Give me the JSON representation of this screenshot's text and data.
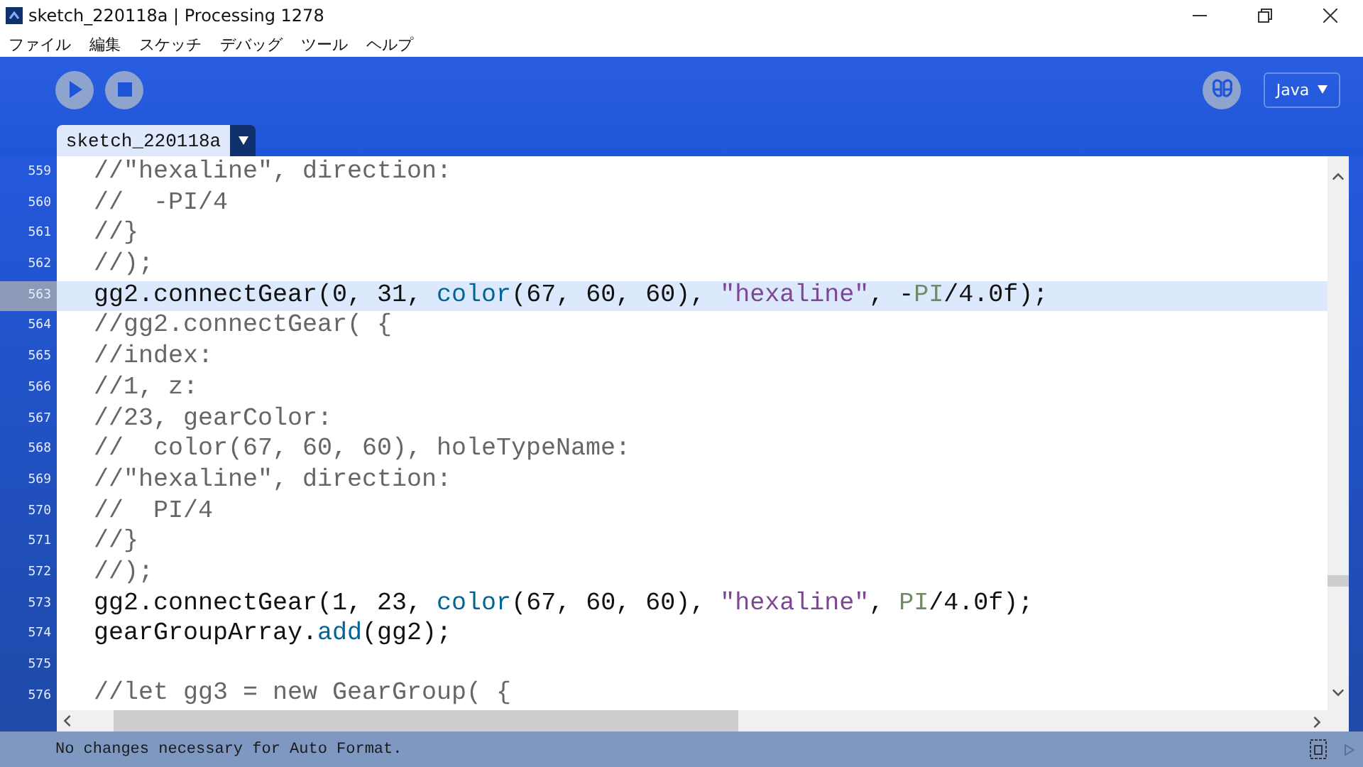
{
  "window": {
    "title": "sketch_220118a | Processing 1278"
  },
  "menu": [
    "ファイル",
    "編集",
    "スケッチ",
    "デバッグ",
    "ツール",
    "ヘルプ"
  ],
  "tabs": [
    {
      "label": "sketch_220118a",
      "selected": true
    }
  ],
  "mode": {
    "label": "Java"
  },
  "editor": {
    "lines": [
      {
        "number": "559",
        "current": false,
        "tokens": [
          {
            "kind": "comment",
            "text": "//\"hexaline\", direction:"
          }
        ]
      },
      {
        "number": "560",
        "current": false,
        "tokens": [
          {
            "kind": "comment",
            "text": "//  -PI/4"
          }
        ]
      },
      {
        "number": "561",
        "current": false,
        "tokens": [
          {
            "kind": "comment",
            "text": "//}"
          }
        ]
      },
      {
        "number": "562",
        "current": false,
        "tokens": [
          {
            "kind": "comment",
            "text": "//);"
          }
        ]
      },
      {
        "number": "563",
        "current": true,
        "tokens": [
          {
            "kind": "plain",
            "text": "gg2.connectGear(0, 31, "
          },
          {
            "kind": "keyword",
            "text": "color"
          },
          {
            "kind": "plain",
            "text": "(67, 60, 60), "
          },
          {
            "kind": "string",
            "text": "\"hexaline\""
          },
          {
            "kind": "plain",
            "text": ", -"
          },
          {
            "kind": "constant",
            "text": "PI"
          },
          {
            "kind": "plain",
            "text": "/4.0f);"
          }
        ]
      },
      {
        "number": "564",
        "current": false,
        "tokens": [
          {
            "kind": "comment",
            "text": "//gg2.connectGear( {"
          }
        ]
      },
      {
        "number": "565",
        "current": false,
        "tokens": [
          {
            "kind": "comment",
            "text": "//index:"
          }
        ]
      },
      {
        "number": "566",
        "current": false,
        "tokens": [
          {
            "kind": "comment",
            "text": "//1, z:"
          }
        ]
      },
      {
        "number": "567",
        "current": false,
        "tokens": [
          {
            "kind": "comment",
            "text": "//23, gearColor:"
          }
        ]
      },
      {
        "number": "568",
        "current": false,
        "tokens": [
          {
            "kind": "comment",
            "text": "//  color(67, 60, 60), holeTypeName:"
          }
        ]
      },
      {
        "number": "569",
        "current": false,
        "tokens": [
          {
            "kind": "comment",
            "text": "//\"hexaline\", direction:"
          }
        ]
      },
      {
        "number": "570",
        "current": false,
        "tokens": [
          {
            "kind": "comment",
            "text": "//  PI/4"
          }
        ]
      },
      {
        "number": "571",
        "current": false,
        "tokens": [
          {
            "kind": "comment",
            "text": "//}"
          }
        ]
      },
      {
        "number": "572",
        "current": false,
        "tokens": [
          {
            "kind": "comment",
            "text": "//);"
          }
        ]
      },
      {
        "number": "573",
        "current": false,
        "tokens": [
          {
            "kind": "plain",
            "text": "gg2.connectGear(1, 23, "
          },
          {
            "kind": "keyword",
            "text": "color"
          },
          {
            "kind": "plain",
            "text": "(67, 60, 60), "
          },
          {
            "kind": "string",
            "text": "\"hexaline\""
          },
          {
            "kind": "plain",
            "text": ", "
          },
          {
            "kind": "constant",
            "text": "PI"
          },
          {
            "kind": "plain",
            "text": "/4.0f);"
          }
        ]
      },
      {
        "number": "574",
        "current": false,
        "tokens": [
          {
            "kind": "plain",
            "text": "gearGroupArray."
          },
          {
            "kind": "keyword",
            "text": "add"
          },
          {
            "kind": "plain",
            "text": "(gg2);"
          }
        ]
      },
      {
        "number": "575",
        "current": false
      },
      {
        "number": "576",
        "current": false,
        "tokens": [
          {
            "kind": "comment",
            "text": "//let gg3 = new GearGroup( {"
          }
        ]
      }
    ]
  },
  "status": {
    "message": "No changes necessary for Auto Format."
  }
}
